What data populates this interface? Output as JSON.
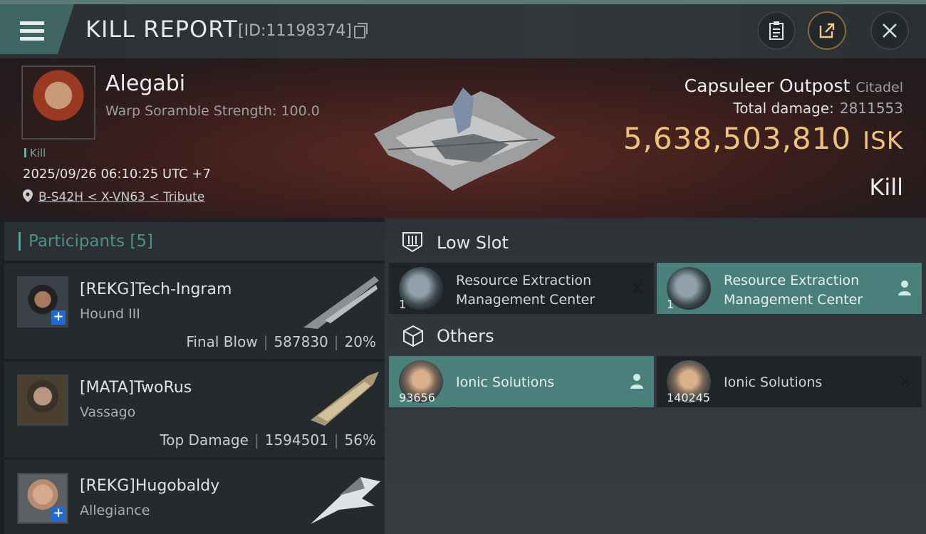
{
  "header": {
    "title": "KILL REPORT",
    "report_id": "[ID:11198374]",
    "buttons": {
      "clipboard": "clipboard-icon",
      "share": "share-icon",
      "close": "close-icon"
    }
  },
  "victim": {
    "name": "Alegabi",
    "subtitle": "Warp Soramble Strength: 100.0",
    "kill_tag": "Kill",
    "time": "2025/09/26 06:10:25 UTC +7",
    "location": "B-S42H < X-VN63 < Tribute"
  },
  "target": {
    "name": "Capsuleer Outpost",
    "class": "Citadel",
    "total_damage_label": "Total damage:",
    "total_damage": "2811553",
    "isk_value": "5,638,503,810",
    "isk_unit": "ISK",
    "result": "Kill"
  },
  "participants": {
    "title": "Participants",
    "count": "[5]",
    "rows": [
      {
        "name": "[REKG]Tech-Ingram",
        "ship": "Hound III",
        "role": "Final Blow",
        "damage": "587830",
        "percent": "20%"
      },
      {
        "name": "[MATA]TwoRus",
        "ship": "Vassago",
        "role": "Top Damage",
        "damage": "1594501",
        "percent": "56%"
      },
      {
        "name": "[REKG]Hugobaldy",
        "ship": "Allegiance",
        "role": "",
        "damage": "",
        "percent": ""
      }
    ]
  },
  "low_slot": {
    "title": "Low Slot",
    "items": [
      {
        "name_line1": "Resource Extraction",
        "name_line2": "Management Center",
        "qty": "1",
        "status": "destroyed"
      },
      {
        "name_line1": "Resource Extraction",
        "name_line2": "Management Center",
        "qty": "1",
        "status": "dropped"
      }
    ]
  },
  "others": {
    "title": "Others",
    "items": [
      {
        "name": "Ionic Solutions",
        "qty": "93656",
        "status": "dropped"
      },
      {
        "name": "Ionic Solutions",
        "qty": "140245",
        "status": "destroyed"
      }
    ]
  },
  "colors": {
    "accent": "#4a807c",
    "isk": "#eec27b",
    "banner": "#3e1f1d"
  }
}
